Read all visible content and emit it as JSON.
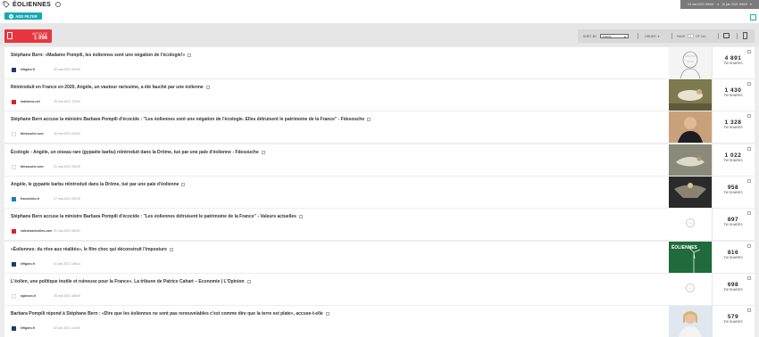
{
  "header": {
    "title": "ÉOLIENNES",
    "date_from": "24 mai 2021 00h00",
    "date_to": "16 juin 2021 00h00"
  },
  "filter": {
    "add_label": "ADD FILTER"
  },
  "summary": {
    "label": "ARTICLES",
    "count": "1 096"
  },
  "controls": {
    "sort_label": "SORT BY",
    "sort_value": "shares",
    "order_label": "ORDER",
    "page_label": "PAGE",
    "page_value": "1",
    "page_of": "OF 110"
  },
  "shares_label": "TW SHARES",
  "articles": [
    {
      "title": "Stéphane Bern: «Madame Pompili, les éoliennes sont une négation de l'écologie!»",
      "source": "lefigaro.fr",
      "date": "30 mai 2021 20h00",
      "shares": "4 891",
      "icon_color": "#1a3a6b",
      "thumb": "sketch"
    },
    {
      "title": "Réintroduit en France en 2020, Angèle, un vautour rarissime, a été fauché par une éolienne",
      "source": "marianne.net",
      "date": "28 mai 2021 17h02",
      "shares": "1 430",
      "icon_color": "#d8212a",
      "thumb": "vulture"
    },
    {
      "title": "Stéphane Bern accuse la ministre Barbara Pompili d'écocide : \"Les éoliennes sont une négation de l'écologie. Elles détruisent le patrimoine de la France\" - Fdesouche",
      "source": "fdesouche.com",
      "date": "30 mai 2021 22h43",
      "shares": "1 328",
      "icon_color": "#ffffff",
      "thumb": "man"
    },
    {
      "title": "Écologie : Angèle, un oiseau rare (gypaète barbu) réintroduit dans la Drôme, tué par une pale d'éolienne - Fdesouche",
      "source": "fdesouche.com",
      "date": "31 mai 2021 20h20",
      "shares": "1 022",
      "icon_color": "#ffffff",
      "thumb": "bird"
    },
    {
      "title": "Angèle, le gypaète barbu réintroduit dans la Drôme, tué par une pale d'éolienne",
      "source": "francebleu.fr",
      "date": "27 mai 2021 20h30",
      "shares": "958",
      "icon_color": "#1a7fc1",
      "thumb": "bird2"
    },
    {
      "title": "Stéphane Bern accuse la ministre Barbara Pompili d'écocide : \"Les éoliennes détruisent le patrimoine de la France\" - Valeurs actuelles",
      "source": "valeursactuelles.com",
      "date": "31 mai 2021 08h01",
      "shares": "897",
      "icon_color": "#d8212a",
      "thumb": "none"
    },
    {
      "title": "«Éoliennes: du rêve aux réalités», le film choc qui déconstruit l'imposture",
      "source": "lefigaro.fr",
      "date": "01 juin 2021 18h14",
      "shares": "816",
      "icon_color": "#1a3a6b",
      "thumb": "poster"
    },
    {
      "title": "L'éolien, une politique inutile et ruineuse pour la France». La tribune de Patrice Cahart – Economie | L'Opinion",
      "source": "lopinion.fr",
      "date": "25 mai 2021 18h00",
      "shares": "698",
      "icon_color": "#ffffff",
      "thumb": "none"
    },
    {
      "title": "Barbara Pompili répond à Stéphane Bern : «Dire que les éoliennes ne sont pas renouvelables c'est comme dire que la terre est plate», accuse-t-elle",
      "source": "lefigaro.fr",
      "date": "02 juin 2021 11h05",
      "shares": "579",
      "icon_color": "#1a3a6b",
      "thumb": "woman"
    }
  ]
}
